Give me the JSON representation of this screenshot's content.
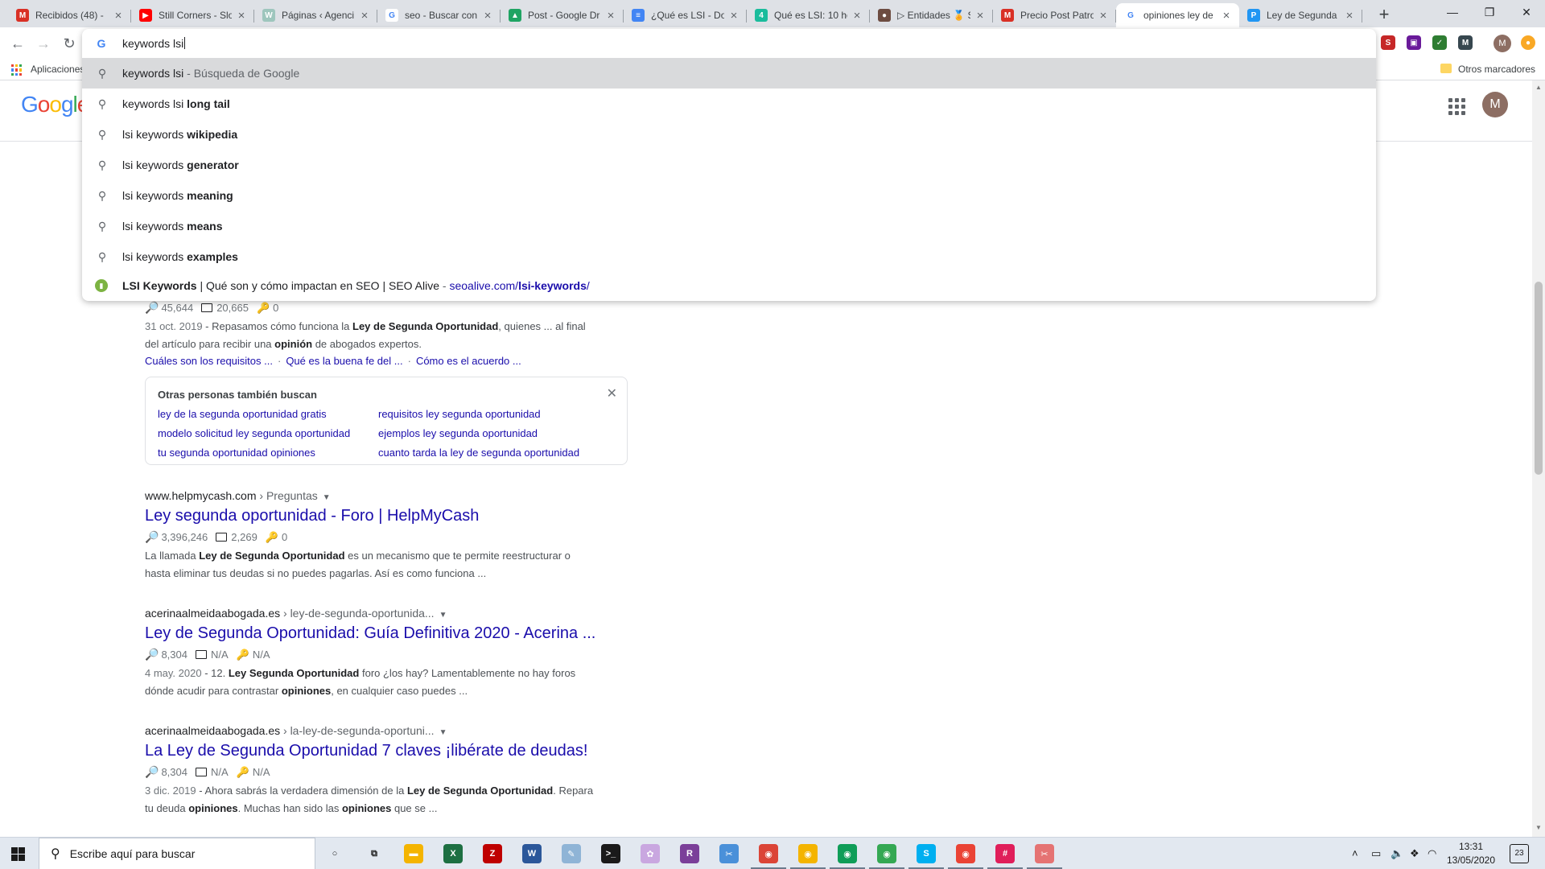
{
  "tabs": [
    {
      "title": "Recibidos (48) - ",
      "icon": "gmail-icon",
      "color": "#d93025",
      "glyph": "M"
    },
    {
      "title": "Still Corners - Slo",
      "icon": "youtube-icon",
      "color": "#ff0000",
      "glyph": "▶"
    },
    {
      "title": "Páginas ‹ Agenci",
      "icon": "wordpress-icon",
      "color": "#9ec6bd",
      "glyph": "W"
    },
    {
      "title": "seo - Buscar con",
      "icon": "google-icon",
      "color": "#ffffff",
      "glyph": "G"
    },
    {
      "title": "Post - Google Dr",
      "icon": "drive-icon",
      "color": "#1fa463",
      "glyph": "▲"
    },
    {
      "title": "¿Qué es LSI - Do",
      "icon": "docs-icon",
      "color": "#4285f4",
      "glyph": "≡"
    },
    {
      "title": "Qué es LSI: 10 he",
      "icon": "site-icon",
      "color": "#1abc9c",
      "glyph": "4"
    },
    {
      "title": "▷ Entidades 🏅 S",
      "icon": "site-avatar-icon",
      "color": "#6d4c41",
      "glyph": "●"
    },
    {
      "title": "Precio Post Patro",
      "icon": "gmail-icon",
      "color": "#d93025",
      "glyph": "M"
    },
    {
      "title": "opiniones ley de",
      "icon": "google-icon",
      "color": "#ffffff",
      "glyph": "G",
      "active": true
    },
    {
      "title": "Ley de Segunda ",
      "icon": "site-icon",
      "color": "#2196f3",
      "glyph": "P"
    }
  ],
  "omnibox": {
    "typed": "keywords lsi",
    "suggestions": [
      {
        "pre": "keywords lsi",
        "bold": "",
        "desc": " - Búsqueda de Google",
        "highlight": true
      },
      {
        "pre": "keywords lsi ",
        "bold": "long tail",
        "desc": ""
      },
      {
        "pre": "lsi keywords ",
        "bold": "wikipedia",
        "desc": ""
      },
      {
        "pre": "lsi keywords ",
        "bold": "generator",
        "desc": ""
      },
      {
        "pre": "lsi keywords ",
        "bold": "meaning",
        "desc": ""
      },
      {
        "pre": "lsi keywords ",
        "bold": "means",
        "desc": ""
      },
      {
        "pre": "lsi keywords ",
        "bold": "examples",
        "desc": ""
      }
    ],
    "history": {
      "bold": "LSI Keywords",
      "rest": " | Qué son y cómo impactan en SEO | SEO Alive",
      "sep": " - ",
      "url_pre": "seoalive.com/",
      "url_bold": "lsi-keywords",
      "url_post": "/"
    }
  },
  "bookmarks": {
    "apps": "Aplicaciones",
    "other": "Otros marcadores"
  },
  "google_logo": "Google",
  "avatar_letter": "M",
  "results": {
    "first": {
      "metrics": [
        "45,644",
        "20,665",
        "0"
      ],
      "date": "31 oct. 2019",
      "s1": " - Repasamos cómo funciona la ",
      "b1": "Ley de Segunda Oportunidad",
      "s2": ", quienes ... al final",
      "s3": "del artículo para recibir una ",
      "b2": "opinión",
      "s4": " de abogados expertos.",
      "sitelinks": [
        "Cuáles son los requisitos ...",
        "Qué es la buena fe del ...",
        "Cómo es el acuerdo ..."
      ]
    },
    "pasf": {
      "title": "Otras personas también buscan",
      "links": [
        "ley de la segunda oportunidad gratis",
        "requisitos ley segunda oportunidad",
        "modelo solicitud ley segunda oportunidad",
        "ejemplos ley segunda oportunidad",
        "tu segunda oportunidad opiniones",
        "cuanto tarda la ley de segunda oportunidad"
      ]
    },
    "r2": {
      "domain": "www.helpmycash.com",
      "path": " › Preguntas",
      "title": "Ley segunda oportunidad - Foro | HelpMyCash",
      "metrics": [
        "3,396,246",
        "2,269",
        "0"
      ],
      "s1": "La llamada ",
      "b1": "Ley de Segunda Oportunidad",
      "s2": " es un mecanismo que te permite reestructurar o",
      "s3": "hasta eliminar tus deudas si no puedes pagarlas. Así es como funciona ..."
    },
    "r3": {
      "domain": "acerinaalmeidaabogada.es",
      "path": " › ley-de-segunda-oportunida...",
      "title": "Ley de Segunda Oportunidad: Guía Definitiva 2020 - Acerina ...",
      "metrics": [
        "8,304",
        "N/A",
        "N/A"
      ],
      "date": "4 may. 2020",
      "s1": " - 12. ",
      "b1": "Ley Segunda Oportunidad",
      "s2": " foro ¿los hay? Lamentablemente no hay foros",
      "s3": "dónde acudir para contrastar ",
      "b2": "opiniones",
      "s4": ", en cualquier caso puedes ..."
    },
    "r4": {
      "domain": "acerinaalmeidaabogada.es",
      "path": " › la-ley-de-segunda-oportuni...",
      "title": "La Ley de Segunda Oportunidad 7 claves ¡libérate de deudas!",
      "metrics": [
        "8,304",
        "N/A",
        "N/A"
      ],
      "date": "3 dic. 2019",
      "s1": " - Ahora sabrás la verdadera dimensión de la ",
      "b1": "Ley de Segunda Oportunidad",
      "s2": ". Repara",
      "s3": "tu deuda ",
      "b2": "opiniones",
      "s4": ". Muchas han sido las ",
      "b3": "opiniones",
      "s5": " que se ..."
    }
  },
  "taskbar": {
    "search_placeholder": "Escribe aquí para buscar",
    "time": "13:31",
    "date": "13/05/2020",
    "notif_count": "23",
    "apps": [
      {
        "name": "cortana-icon",
        "glyph": "○",
        "color": "transparent",
        "fg": "#1a1a1a"
      },
      {
        "name": "task-view-icon",
        "glyph": "⧉",
        "color": "transparent",
        "fg": "#1a1a1a"
      },
      {
        "name": "file-explorer-icon",
        "glyph": "▬",
        "color": "#f4b400",
        "fg": "#fff"
      },
      {
        "name": "excel-icon",
        "glyph": "X",
        "color": "#1d6f42",
        "fg": "#fff"
      },
      {
        "name": "filezilla-icon",
        "glyph": "Z",
        "color": "#bf0000",
        "fg": "#fff"
      },
      {
        "name": "word-icon",
        "glyph": "W",
        "color": "#2b579a",
        "fg": "#fff"
      },
      {
        "name": "notepad-icon",
        "glyph": "✎",
        "color": "#8fb4d6",
        "fg": "#fff"
      },
      {
        "name": "terminal-icon",
        "glyph": ">_",
        "color": "#1a1a1a",
        "fg": "#fff"
      },
      {
        "name": "paint-icon",
        "glyph": "✿",
        "color": "#c9a7e0",
        "fg": "#fff"
      },
      {
        "name": "winrar-icon",
        "glyph": "R",
        "color": "#7b3f99",
        "fg": "#fff"
      },
      {
        "name": "snipping-icon",
        "glyph": "✂",
        "color": "#4a90d9",
        "fg": "#fff"
      },
      {
        "name": "chrome-profile-icon",
        "glyph": "◉",
        "color": "#db4437",
        "fg": "#fff"
      },
      {
        "name": "chrome-icon",
        "glyph": "◉",
        "color": "#f4b400",
        "fg": "#fff"
      },
      {
        "name": "chrome-profile-icon",
        "glyph": "◉",
        "color": "#0f9d58",
        "fg": "#fff"
      },
      {
        "name": "chrome-profile-icon",
        "glyph": "◉",
        "color": "#34a853",
        "fg": "#fff"
      },
      {
        "name": "skype-icon",
        "glyph": "S",
        "color": "#00aff0",
        "fg": "#fff"
      },
      {
        "name": "chrome-profile-icon",
        "glyph": "◉",
        "color": "#ea4335",
        "fg": "#fff"
      },
      {
        "name": "slack-icon",
        "glyph": "#",
        "color": "#e01e5a",
        "fg": "#fff"
      },
      {
        "name": "snip-sketch-icon",
        "glyph": "✂",
        "color": "#e57373",
        "fg": "#fff"
      }
    ]
  }
}
